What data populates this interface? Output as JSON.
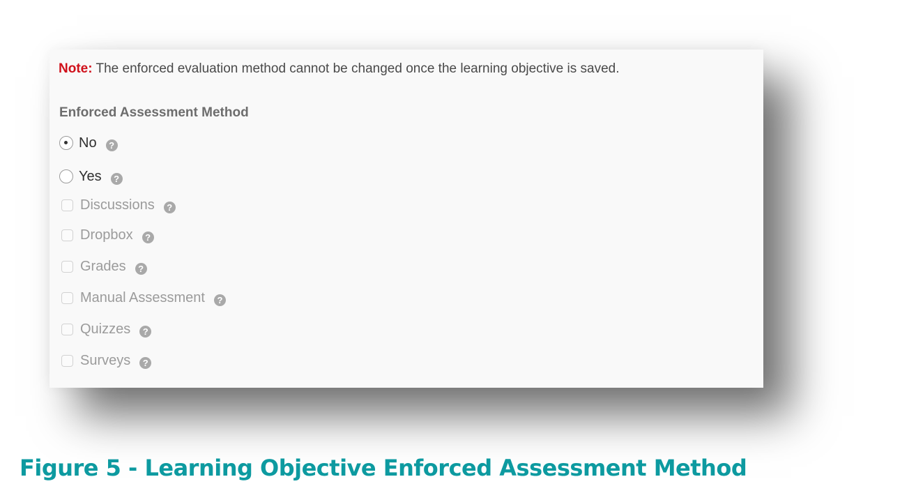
{
  "note": {
    "label": "Note:",
    "text": " The enforced evaluation method cannot be changed once the learning objective is saved."
  },
  "section_title": "Enforced Assessment Method",
  "radio_options": [
    {
      "label": "No",
      "checked": true,
      "help_icon": "question-circle-icon"
    },
    {
      "label": "Yes",
      "checked": false,
      "help_icon": "question-circle-icon"
    }
  ],
  "checkbox_options": [
    {
      "label": "Discussions",
      "checked": false,
      "disabled": true,
      "help_icon": "question-circle-icon"
    },
    {
      "label": "Dropbox",
      "checked": false,
      "disabled": true,
      "help_icon": "question-circle-icon"
    },
    {
      "label": "Grades",
      "checked": false,
      "disabled": true,
      "help_icon": "question-circle-icon"
    },
    {
      "label": "Manual Assessment",
      "checked": false,
      "disabled": true,
      "help_icon": "question-circle-icon"
    },
    {
      "label": "Quizzes",
      "checked": false,
      "disabled": true,
      "help_icon": "question-circle-icon"
    },
    {
      "label": "Surveys",
      "checked": false,
      "disabled": true,
      "help_icon": "question-circle-icon"
    }
  ],
  "help_glyph": "?",
  "caption": "Figure 5 - Learning Objective Enforced Assessment Method",
  "colors": {
    "note_label": "#d0111b",
    "caption": "#0d9aa0",
    "panel_bg": "#f9f9f9"
  }
}
